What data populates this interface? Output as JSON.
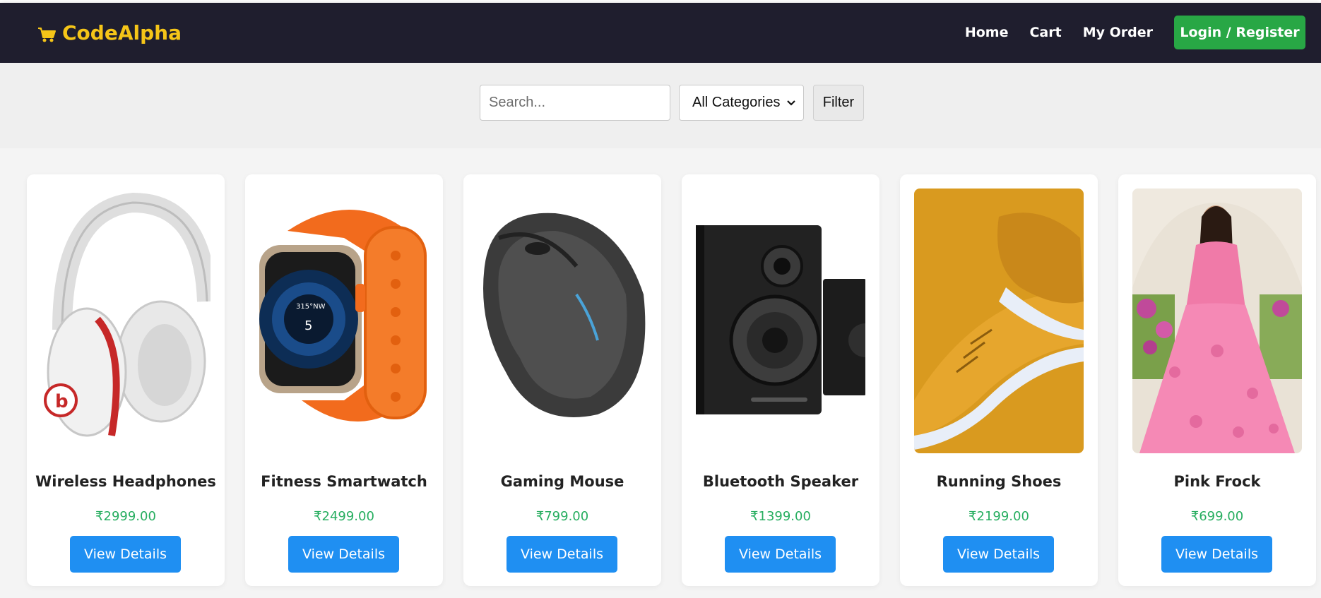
{
  "brand": {
    "name": "CodeAlpha",
    "color": "#f5c518"
  },
  "nav": {
    "links": [
      "Home",
      "Cart",
      "My Order"
    ],
    "login_label": "Login / Register"
  },
  "filter": {
    "search_placeholder": "Search...",
    "category_selected": "All Categories",
    "filter_label": "Filter"
  },
  "products": [
    {
      "name": "Wireless Headphones",
      "price": "₹2999.00",
      "button": "View Details",
      "image": "headphones"
    },
    {
      "name": "Fitness Smartwatch",
      "price": "₹2499.00",
      "button": "View Details",
      "image": "smartwatch"
    },
    {
      "name": "Gaming Mouse",
      "price": "₹799.00",
      "button": "View Details",
      "image": "mouse"
    },
    {
      "name": "Bluetooth Speaker",
      "price": "₹1399.00",
      "button": "View Details",
      "image": "speaker"
    },
    {
      "name": "Running Shoes",
      "price": "₹2199.00",
      "button": "View Details",
      "image": "shoes"
    },
    {
      "name": "Pink Frock",
      "price": "₹699.00",
      "button": "View Details",
      "image": "frock"
    }
  ],
  "colors": {
    "navbar": "#1f1e2e",
    "login_button": "#28a745",
    "view_button": "#1f8ff2",
    "price": "#27ae60"
  }
}
